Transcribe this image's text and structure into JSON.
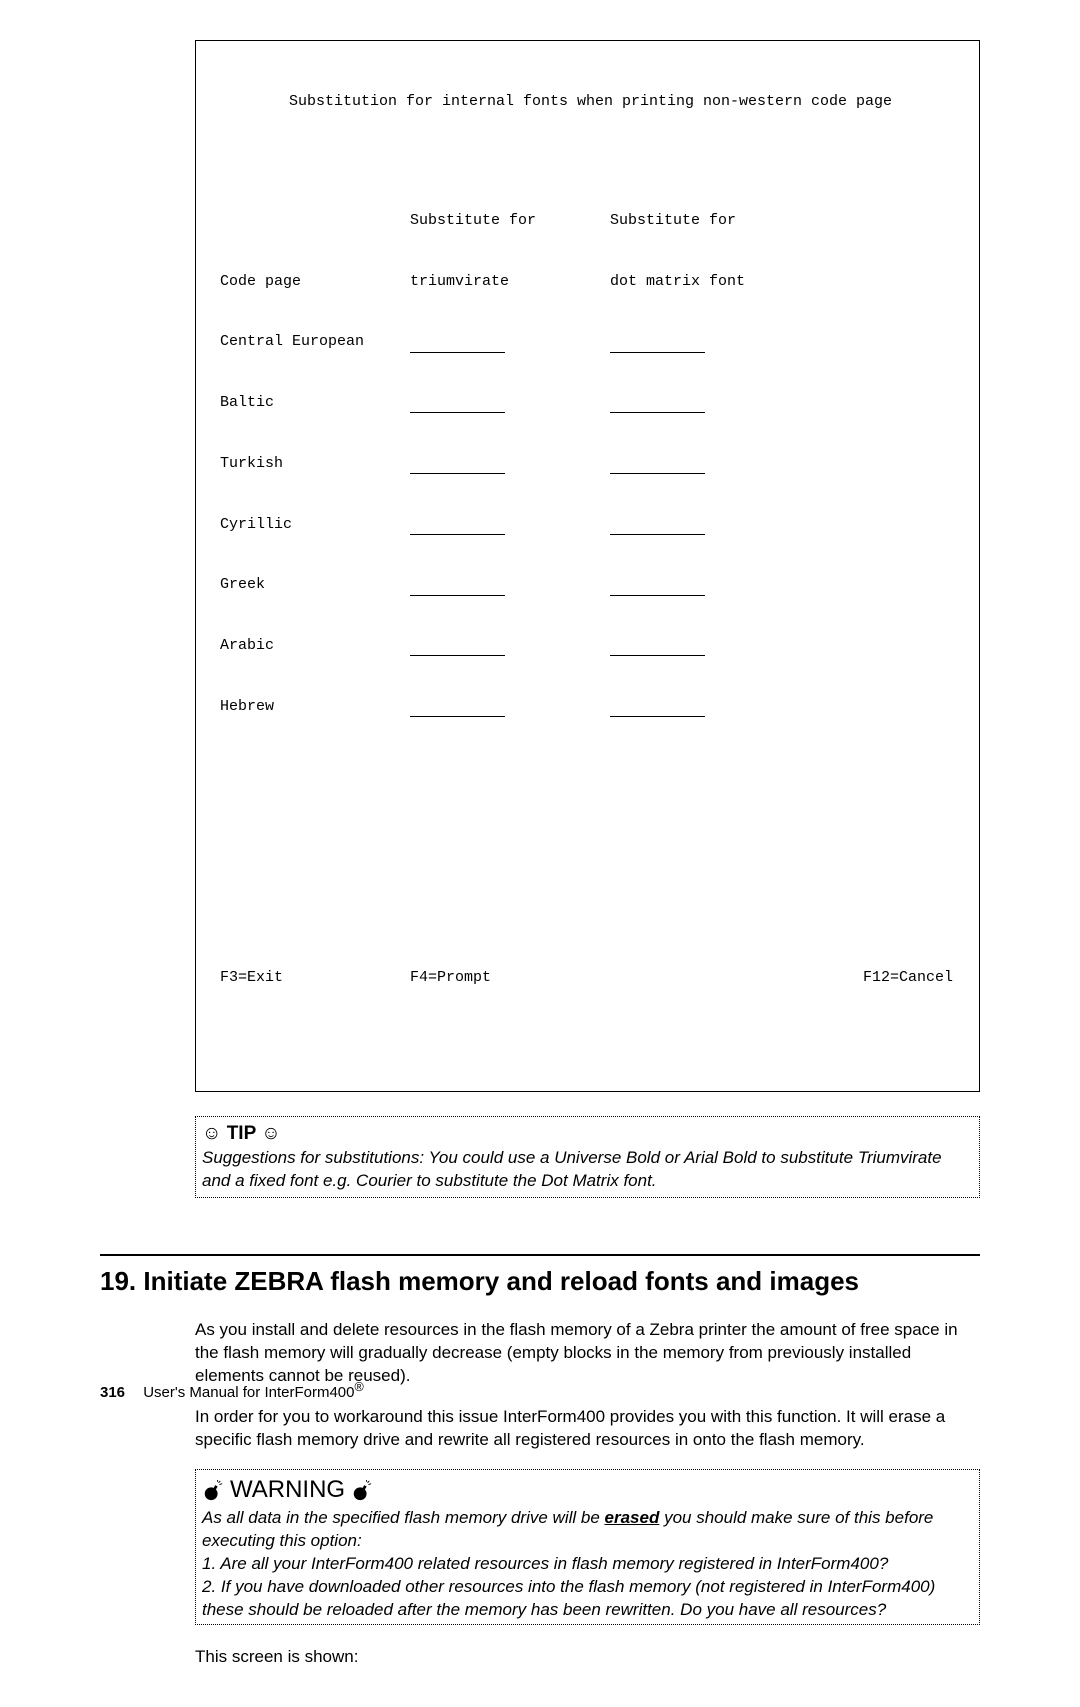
{
  "terminal": {
    "title": "Substitution for internal fonts when printing non-western code page",
    "col2_header_line1": "Substitute for",
    "col3_header_line1": "Substitute for",
    "col2_header_line2": "triumvirate",
    "col3_header_line2": "dot matrix font",
    "rows": [
      "Code page",
      "Central European",
      "Baltic",
      "Turkish",
      "Cyrillic",
      "Greek",
      "Arabic",
      "Hebrew"
    ],
    "f3": "F3=Exit",
    "f4": "F4=Prompt",
    "f12": "F12=Cancel"
  },
  "tip": {
    "smiley": "☺",
    "title": "TIP",
    "body": "Suggestions for substitutions: You could use a Universe Bold or Arial Bold to substitute Triumvirate and a fixed font e.g. Courier to substitute the Dot Matrix font."
  },
  "section": {
    "heading": "19. Initiate ZEBRA flash memory and reload fonts and images",
    "para1": "As you install and delete resources in the flash memory of a Zebra printer the amount of free space in the flash memory will gradually decrease (empty blocks in the memory from previously installed elements cannot be reused).",
    "para2": "In order for you to workaround this issue InterForm400 provides you with this function. It will erase a specific flash memory drive and rewrite all registered resources in onto the flash memory."
  },
  "warning": {
    "title": "WARNING",
    "lead_space": " ",
    "line1a": "As all data in the specified flash memory drive will be ",
    "erased": "erased",
    "line1b": " you should make sure of this before executing this option:",
    "line2": "1. Are all your InterForm400 related resources in flash memory registered in InterForm400?",
    "line3": "2. If you have downloaded other resources into the flash memory (not registered in InterForm400) these should be reloaded after the memory has been rewritten. Do you have all resources?"
  },
  "after_warning": "This screen is shown:",
  "footer": {
    "page": "316",
    "text": "User's Manual for InterForm400",
    "reg": "®"
  }
}
